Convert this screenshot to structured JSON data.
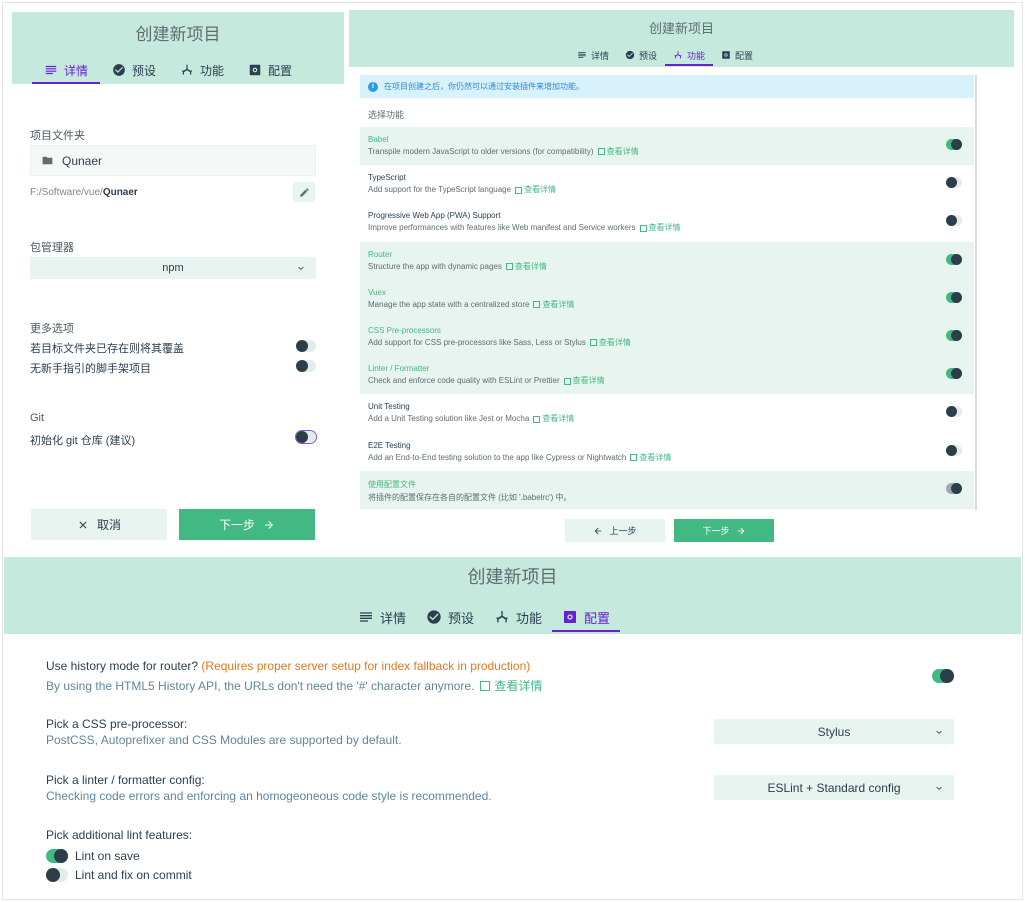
{
  "header_title": "创建新项目",
  "tabs": {
    "details": "详情",
    "presets": "预设",
    "features": "功能",
    "config": "配置"
  },
  "panel1": {
    "folder_section": "项目文件夹",
    "folder_name": "Qunaer",
    "path_prefix": "F:/Software/vue/",
    "path_name": "Qunaer",
    "pkg_manager_section": "包管理器",
    "pkg_manager_value": "npm",
    "more_options_section": "更多选项",
    "option_overwrite": "若目标文件夹已存在则将其覆盖",
    "option_no_guide": "无新手指引的脚手架项目",
    "git_section": "Git",
    "git_init": "初始化 git 仓库 (建议)",
    "cancel_label": "取消",
    "next_label": "下一步"
  },
  "panel2": {
    "info_text": "在项目创建之后，你仍然可以通过安装插件来增加功能。",
    "select_features": "选择功能",
    "more_label": "查看详情",
    "prev_label": "上一步",
    "next_label": "下一步",
    "features": [
      {
        "name": "Babel",
        "desc": "Transpile modern JavaScript to older versions (for compatibility)",
        "enabled": true
      },
      {
        "name": "TypeScript",
        "desc": "Add support for the TypeScript language",
        "enabled": false
      },
      {
        "name": "Progressive Web App (PWA) Support",
        "desc": "Improve performances with features like Web manifest and Service workers",
        "enabled": false
      },
      {
        "name": "Router",
        "desc": "Structure the app with dynamic pages",
        "enabled": true
      },
      {
        "name": "Vuex",
        "desc": "Manage the app state with a centralized store",
        "enabled": true
      },
      {
        "name": "CSS Pre-processors",
        "desc": "Add support for CSS pre-processors like Sass, Less or Stylus",
        "enabled": true
      },
      {
        "name": "Linter / Formatter",
        "desc": "Check and enforce code quality with ESLint or Prettier",
        "enabled": true
      },
      {
        "name": "Unit Testing",
        "desc": "Add a Unit Testing solution like Jest or Mocha",
        "enabled": false
      },
      {
        "name": "E2E Testing",
        "desc": "Add an End-to-End testing solution to the app like Cypress or Nightwatch",
        "enabled": false
      },
      {
        "name": "使用配置文件",
        "desc": "将插件的配置保存在各自的配置文件 (比如 '.babelrc') 中。",
        "enabled": true
      }
    ]
  },
  "panel3": {
    "history_q": "Use history mode for router?",
    "history_warn": "(Requires proper server setup for index fallback in production)",
    "history_desc": "By using the HTML5 History API, the URLs don't need the '#' character anymore.",
    "more_label": "查看详情",
    "css_q": "Pick a CSS pre-processor:",
    "css_desc": "PostCSS, Autoprefixer and CSS Modules are supported by default.",
    "css_value": "Stylus",
    "lint_q": "Pick a linter / formatter config:",
    "lint_desc": "Checking code errors and enforcing an homogeoneous code style is recommended.",
    "lint_value": "ESLint + Standard config",
    "lint_features_q": "Pick additional lint features:",
    "lint_on_save": "Lint on save",
    "lint_on_commit": "Lint and fix on commit"
  },
  "colors": {
    "accent": "#42b983",
    "header": "#c5e9dd",
    "active_tab": "#6a1fd0",
    "warning": "#e07a1f"
  }
}
